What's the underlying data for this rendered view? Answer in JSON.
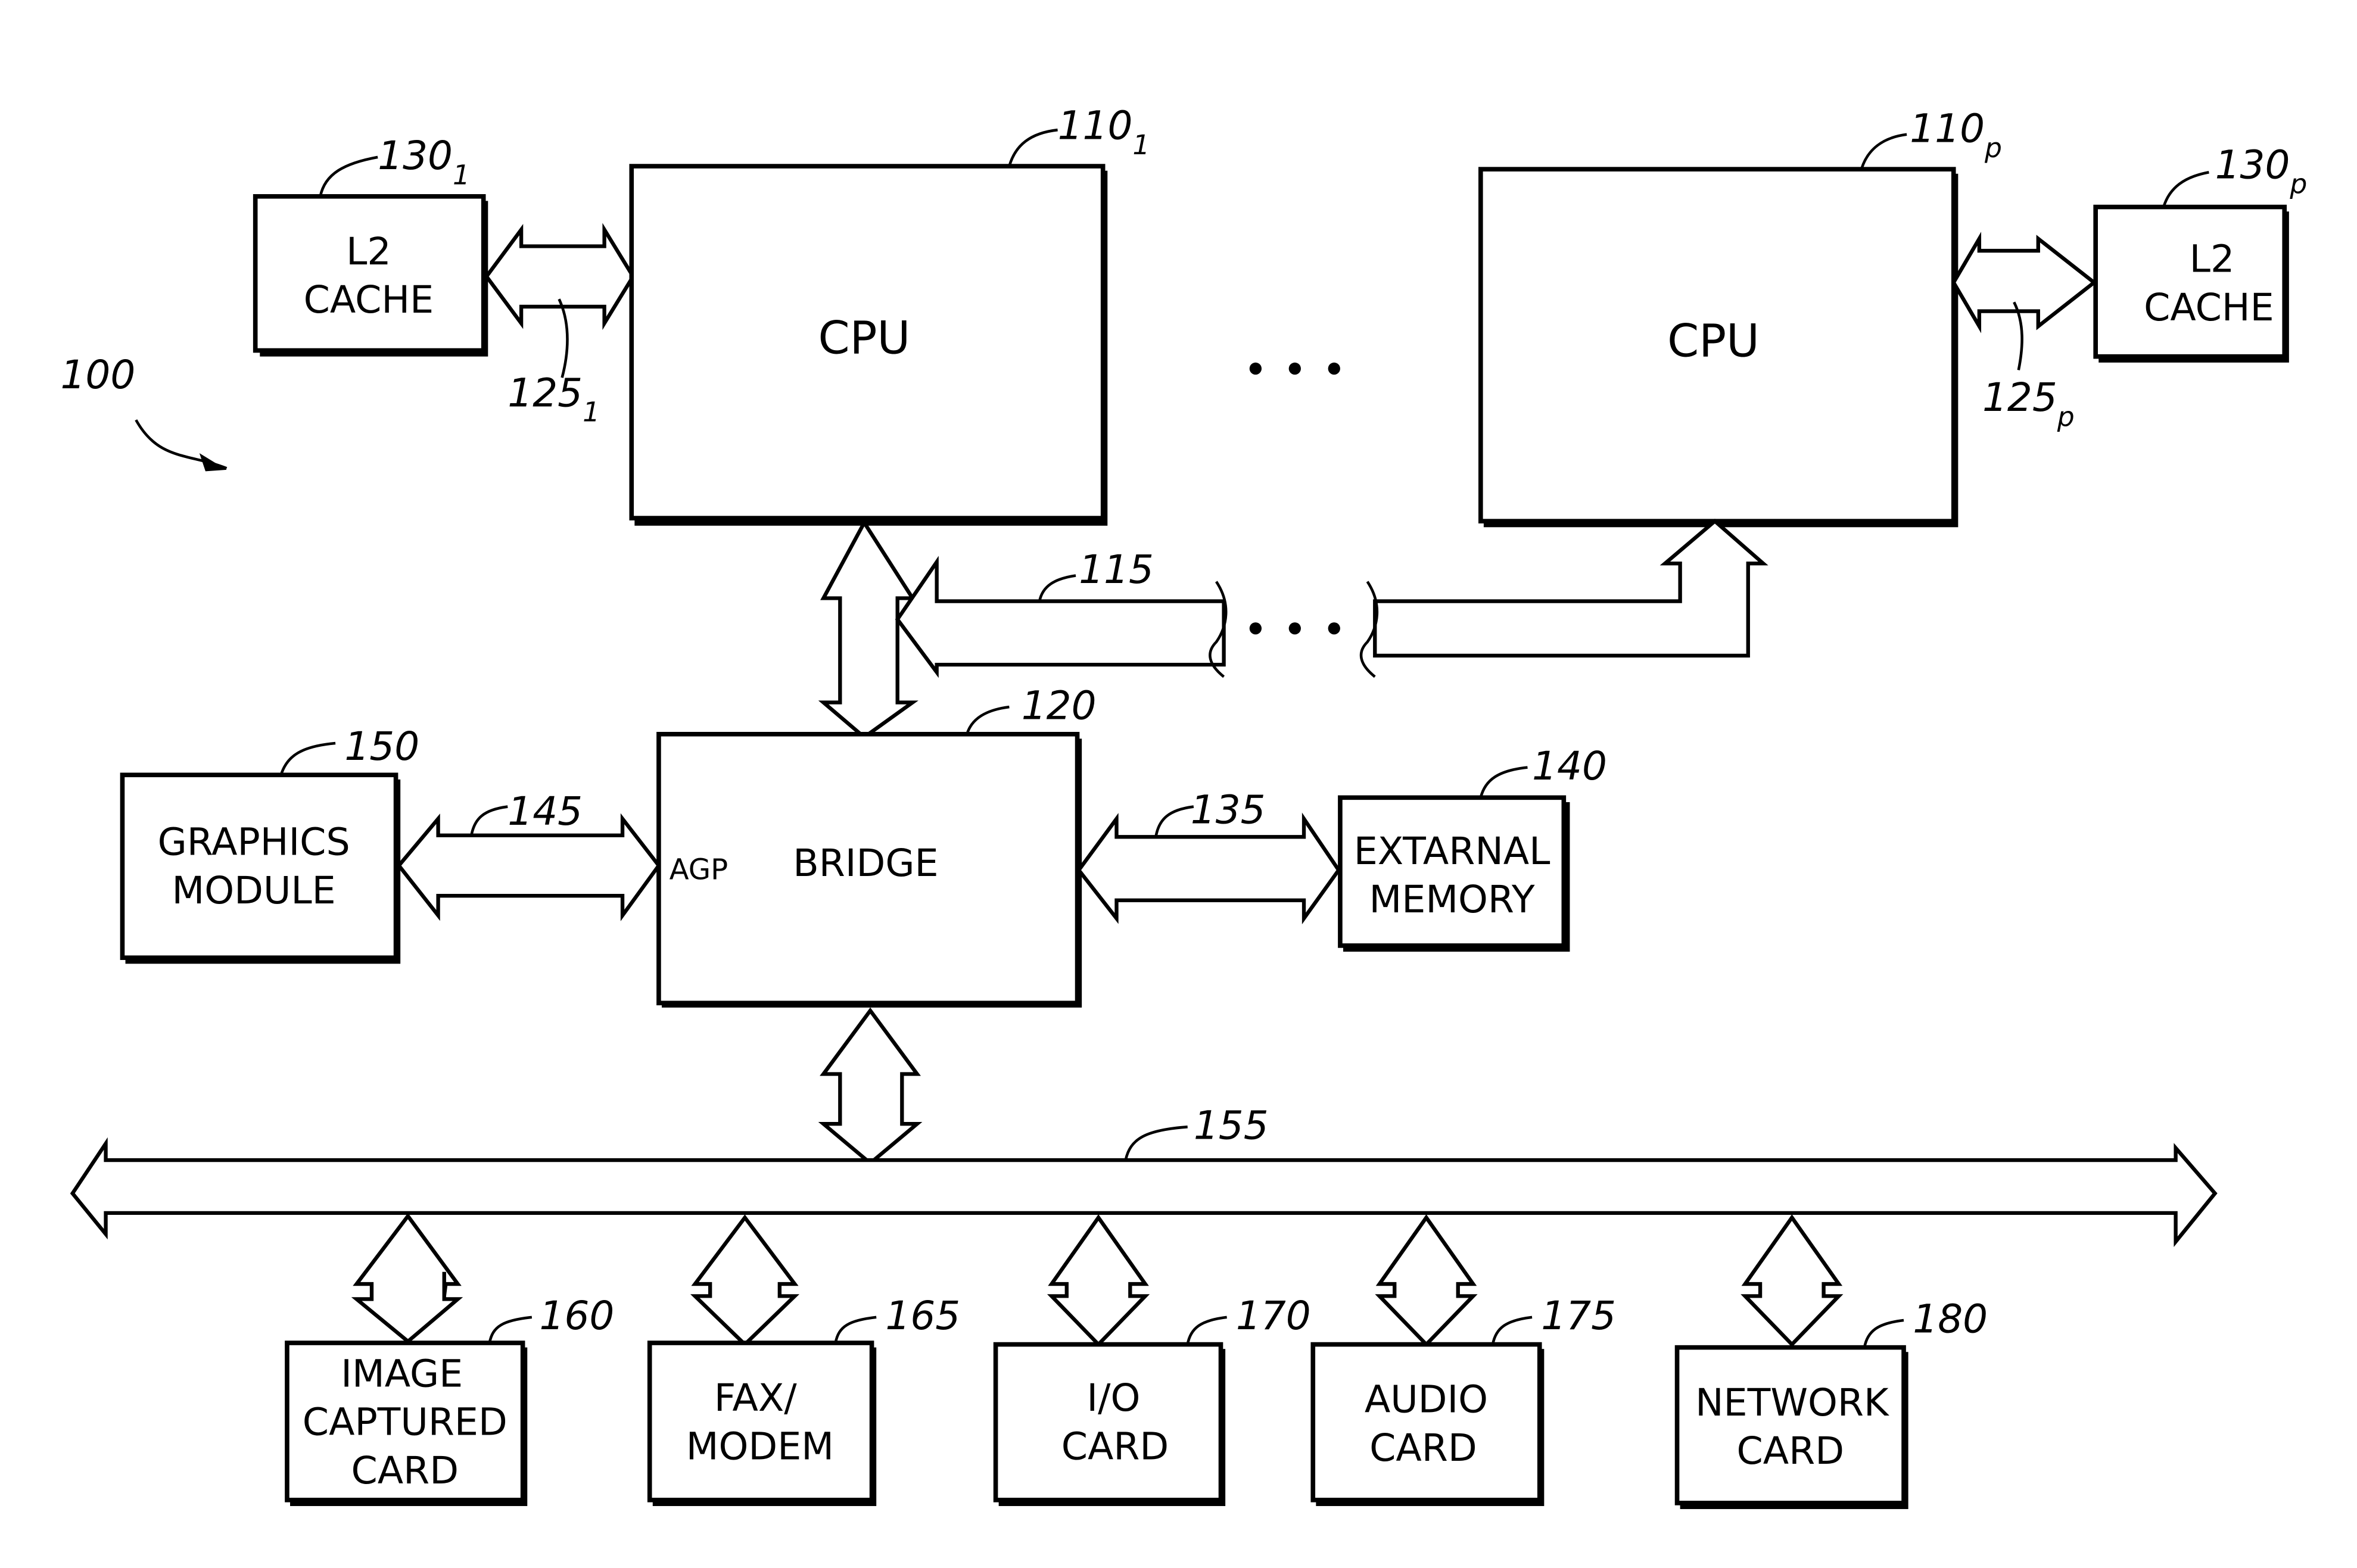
{
  "figure": {
    "system_ref": "100",
    "cpu_left": {
      "label": "CPU",
      "ref": "110",
      "ref_sub": "1"
    },
    "cpu_right": {
      "label": "CPU",
      "ref": "110",
      "ref_sub": "P"
    },
    "cpu_ellipsis": "...",
    "cache_left": {
      "line1": "L2",
      "line2": "CACHE",
      "ref": "130",
      "ref_sub": "1"
    },
    "cache_right": {
      "line1": "L2",
      "line2": "CACHE",
      "ref": "130",
      "ref_sub": "P"
    },
    "link_left": {
      "ref": "125",
      "ref_sub": "1"
    },
    "link_right": {
      "ref": "125",
      "ref_sub": "P"
    },
    "host_bus": {
      "ref": "115",
      "ellipsis": "..."
    },
    "bridge": {
      "label": "BRIDGE",
      "port": "AGP",
      "ref": "120"
    },
    "graphics": {
      "line1": "GRAPHICS",
      "line2": "MODULE",
      "ref": "150"
    },
    "agp_link": {
      "ref": "145"
    },
    "memory": {
      "line1": "EXTARNAL",
      "line2": "MEMORY",
      "ref": "140"
    },
    "memory_link": {
      "ref": "135"
    },
    "pci_bus": {
      "ref": "155"
    },
    "cards": [
      {
        "lines": [
          "IMAGE",
          "CAPTURED",
          "CARD"
        ],
        "ref": "160"
      },
      {
        "lines": [
          "FAX/",
          "MODEM"
        ],
        "ref": "165"
      },
      {
        "lines": [
          "I/O",
          "CARD"
        ],
        "ref": "170"
      },
      {
        "lines": [
          "AUDIO",
          "CARD"
        ],
        "ref": "175"
      },
      {
        "lines": [
          "NETWORK",
          "CARD"
        ],
        "ref": "180"
      }
    ]
  }
}
